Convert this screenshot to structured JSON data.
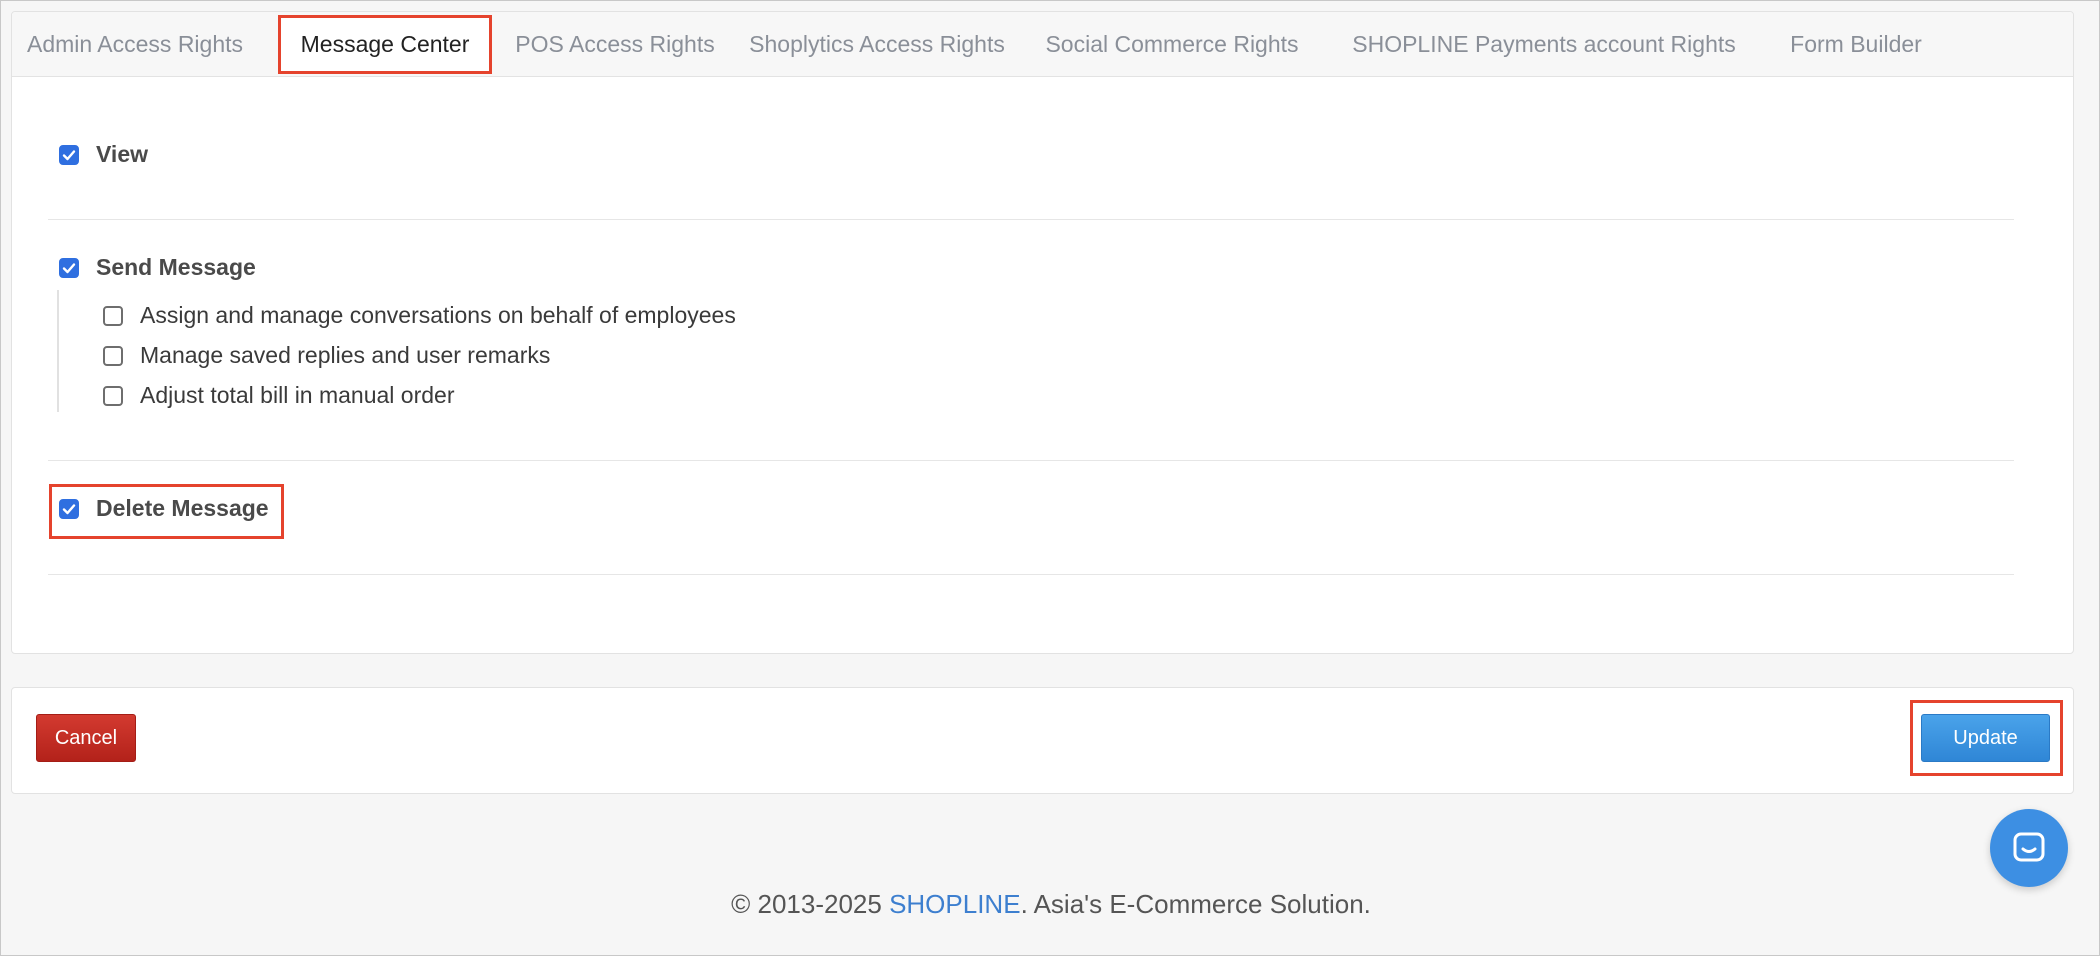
{
  "tabs": [
    {
      "label": "Admin Access Rights",
      "active": false
    },
    {
      "label": "Message Center",
      "active": true
    },
    {
      "label": "POS Access Rights",
      "active": false
    },
    {
      "label": "Shoplytics Access Rights",
      "active": false
    },
    {
      "label": "Social Commerce Rights",
      "active": false
    },
    {
      "label": "SHOPLINE Payments account Rights",
      "active": false
    },
    {
      "label": "Form Builder",
      "active": false
    }
  ],
  "permissions": {
    "view": {
      "label": "View",
      "checked": true
    },
    "send_message": {
      "label": "Send Message",
      "checked": true,
      "sub": [
        {
          "label": "Assign and manage conversations on behalf of employees",
          "checked": false
        },
        {
          "label": "Manage saved replies and user remarks",
          "checked": false
        },
        {
          "label": "Adjust total bill in manual order",
          "checked": false
        }
      ]
    },
    "delete_message": {
      "label": "Delete Message",
      "checked": true
    }
  },
  "actions": {
    "cancel_label": "Cancel",
    "update_label": "Update"
  },
  "footer": {
    "prefix": "© 2013-2025 ",
    "brand": "SHOPLINE",
    "suffix": ". Asia's E-Commerce Solution."
  },
  "colors": {
    "checkbox_checked": "#2f6fe0",
    "highlight": "#e5432d",
    "cancel": "#c42d24",
    "update": "#3a95e0",
    "brand_link": "#3d7fcf"
  },
  "icons": {
    "chat": "chat-bubble-icon",
    "check": "check-icon"
  }
}
